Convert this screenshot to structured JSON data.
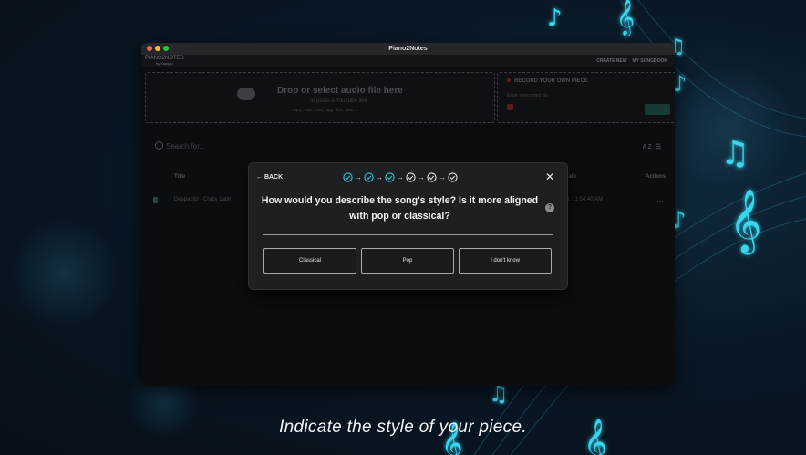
{
  "window": {
    "title": "Piano2Notes"
  },
  "app": {
    "logo": "PIANO2NOTES",
    "logo_sub": "by Klangio",
    "nav": {
      "create_new": "CREATE NEW",
      "my_songbook": "MY SONGBOOK"
    }
  },
  "upload": {
    "title": "Drop or select audio file here",
    "subtitle": "or paste a YouTube link",
    "formats": ".mp3, .wav, .m4a, .ogg, .flac, .aac, ..."
  },
  "record": {
    "title": "RECORD YOUR OWN PIECE",
    "label": "Enter a recorded file"
  },
  "search": {
    "placeholder": "Search for..."
  },
  "sort": {
    "label": "AZ"
  },
  "table": {
    "headers": {
      "title": "Title",
      "date": "Date",
      "actions": "Actions"
    },
    "rows": [
      {
        "title": "Despacito - Crazy Latin",
        "date": "3, 11:54:40 AM",
        "actions": "…"
      }
    ]
  },
  "modal": {
    "back_label": "← BACK",
    "close_label": "✕",
    "question": "How would you describe the song's style? Is it more aligned with pop or classical?",
    "help_label": "?",
    "options": [
      "Classical",
      "Pop",
      "I don't know"
    ],
    "progress": {
      "total_steps": 6,
      "current_step": 4
    }
  },
  "caption": "Indicate the style of your piece.",
  "colors": {
    "accent": "#2ec4d8",
    "modal_bg": "#1d2023",
    "window_bg": "#0b0d10",
    "page_bg": "#0a1826"
  }
}
